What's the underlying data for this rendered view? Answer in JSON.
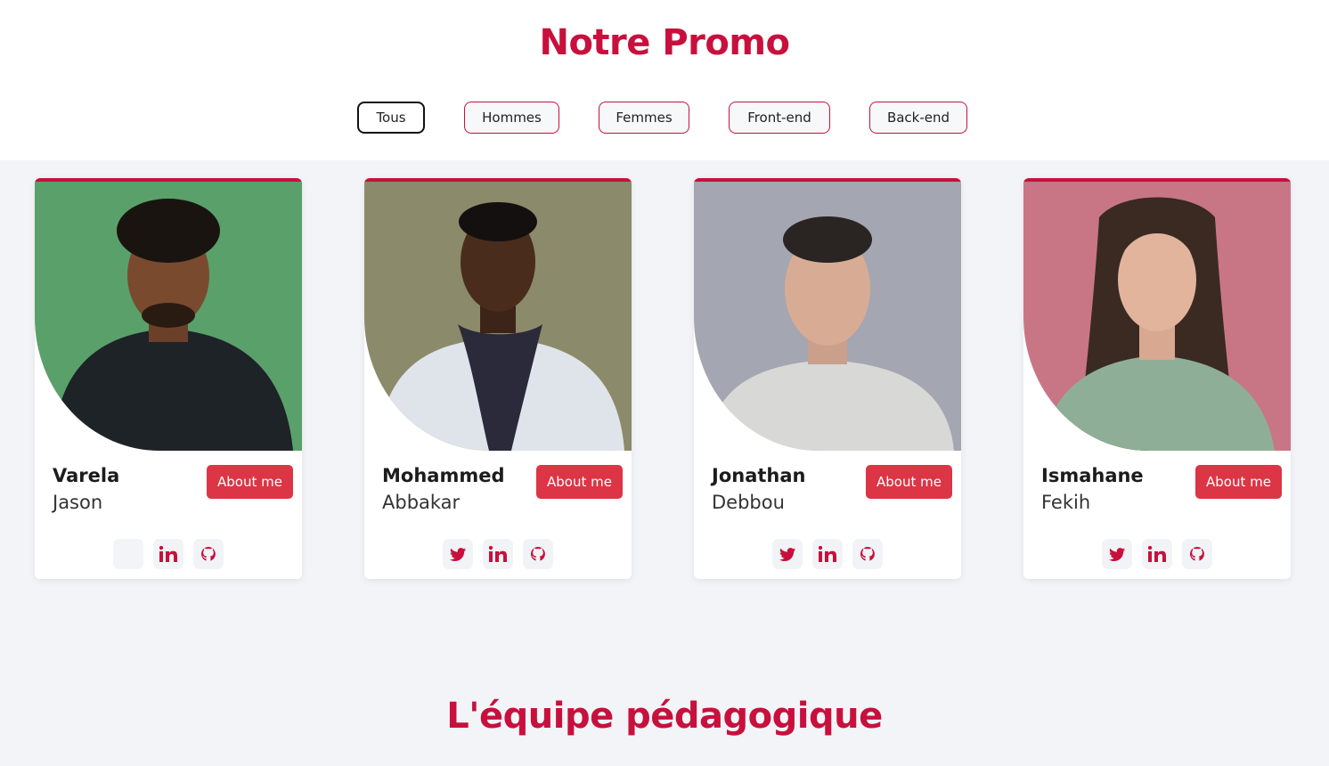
{
  "header": {
    "title": "Notre Promo"
  },
  "filters": [
    {
      "label": "Tous",
      "active": true
    },
    {
      "label": "Hommes",
      "active": false
    },
    {
      "label": "Femmes",
      "active": false
    },
    {
      "label": "Front-end",
      "active": false
    },
    {
      "label": "Back-end",
      "active": false
    }
  ],
  "cards": [
    {
      "first": "Varela",
      "last": "Jason",
      "about": "About me",
      "bg": "#5aa06a",
      "socials": [
        "empty",
        "linkedin-icon",
        "github-icon"
      ]
    },
    {
      "first": "Mohammed",
      "last": "Abbakar",
      "about": "About me",
      "bg": "#8b8a6a",
      "socials": [
        "twitter-icon",
        "linkedin-icon",
        "github-icon"
      ]
    },
    {
      "first": "Jonathan",
      "last": "Debbou",
      "about": "About me",
      "bg": "#a4a6b2",
      "socials": [
        "twitter-icon",
        "linkedin-icon",
        "github-icon"
      ]
    },
    {
      "first": "Ismahane",
      "last": "Fekih",
      "about": "About me",
      "bg": "#c87686",
      "socials": [
        "twitter-icon",
        "linkedin-icon",
        "github-icon"
      ]
    }
  ],
  "section2": {
    "title": "L'équipe pédagogique"
  },
  "colors": {
    "accent": "#c8103d",
    "button": "#dc3545",
    "page_bg": "#f2f4f8"
  }
}
